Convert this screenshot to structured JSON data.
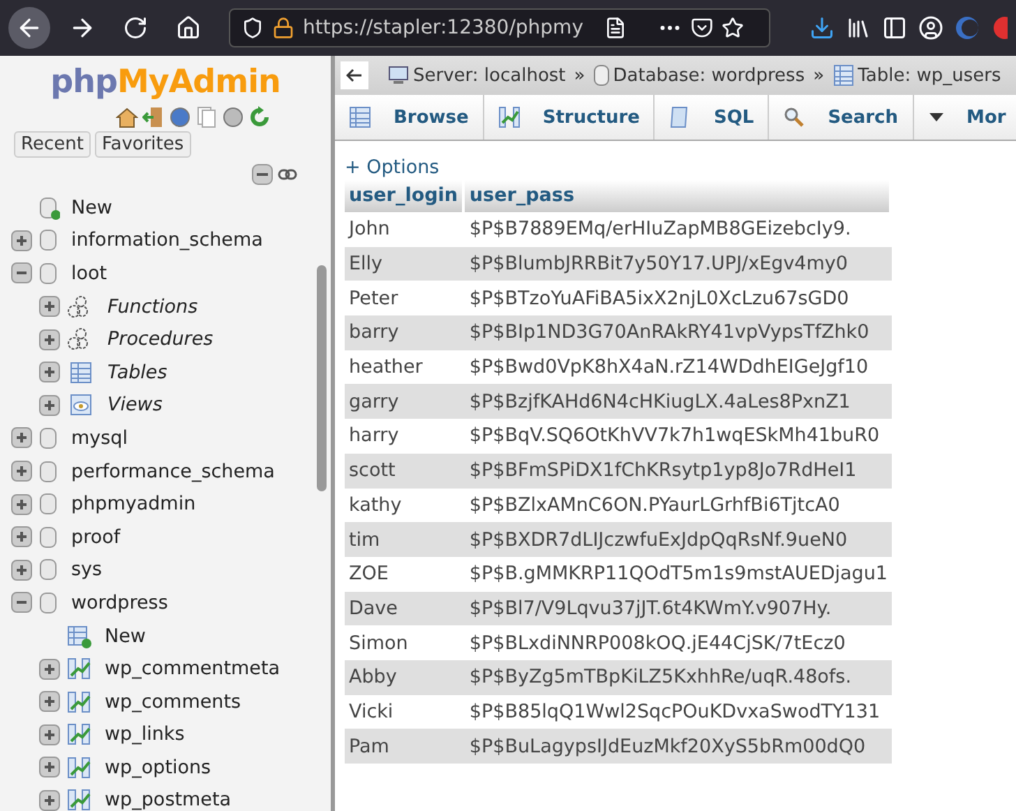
{
  "browser": {
    "url": "https://stapler:12380/phpmy"
  },
  "sidebar": {
    "logo": {
      "prefix": "php",
      "name": "MyAdmin"
    },
    "buttons": [
      "Recent",
      "Favorites"
    ],
    "tree": [
      {
        "label": "New",
        "kind": "new-db"
      },
      {
        "label": "information_schema",
        "kind": "db",
        "expanded": false
      },
      {
        "label": "loot",
        "kind": "db",
        "expanded": true,
        "children": [
          {
            "label": "Functions",
            "kind": "routines",
            "expanded": false
          },
          {
            "label": "Procedures",
            "kind": "routines",
            "expanded": false
          },
          {
            "label": "Tables",
            "kind": "tables",
            "expanded": false
          },
          {
            "label": "Views",
            "kind": "views",
            "expanded": false
          }
        ]
      },
      {
        "label": "mysql",
        "kind": "db",
        "expanded": false
      },
      {
        "label": "performance_schema",
        "kind": "db",
        "expanded": false
      },
      {
        "label": "phpmyadmin",
        "kind": "db",
        "expanded": false
      },
      {
        "label": "proof",
        "kind": "db",
        "expanded": false
      },
      {
        "label": "sys",
        "kind": "db",
        "expanded": false
      },
      {
        "label": "wordpress",
        "kind": "db",
        "expanded": true,
        "children": [
          {
            "label": "New",
            "kind": "new-table"
          },
          {
            "label": "wp_commentmeta",
            "kind": "table",
            "expanded": false
          },
          {
            "label": "wp_comments",
            "kind": "table",
            "expanded": false
          },
          {
            "label": "wp_links",
            "kind": "table",
            "expanded": false
          },
          {
            "label": "wp_options",
            "kind": "table",
            "expanded": false
          },
          {
            "label": "wp_postmeta",
            "kind": "table",
            "expanded": false
          }
        ]
      }
    ]
  },
  "breadcrumbs": [
    {
      "label": "Server: localhost",
      "kind": "server"
    },
    {
      "separator": "»",
      "label": "Database: wordpress",
      "kind": "database"
    },
    {
      "separator": "»",
      "label": "Table: wp_users",
      "kind": "table"
    }
  ],
  "tabs": [
    {
      "label": "Browse",
      "kind": "browse",
      "selected": false
    },
    {
      "label": "Structure",
      "kind": "structure",
      "selected": false
    },
    {
      "label": "SQL",
      "kind": "sql",
      "selected": false
    },
    {
      "label": "Search",
      "kind": "search",
      "selected": false
    },
    {
      "label": "Mor",
      "kind": "more",
      "selected": false
    }
  ],
  "options": "+ Options",
  "table": {
    "columns": [
      "user_login",
      "user_pass"
    ],
    "rows": [
      [
        "John",
        "$P$B7889EMq/erHIuZapMB8GEizebcIy9."
      ],
      [
        "Elly",
        "$P$BlumbJRRBit7y50Y17.UPJ/xEgv4my0"
      ],
      [
        "Peter",
        "$P$BTzoYuAFiBA5ixX2njL0XcLzu67sGD0"
      ],
      [
        "barry",
        "$P$BIp1ND3G70AnRAkRY41vpVypsTfZhk0"
      ],
      [
        "heather",
        "$P$Bwd0VpK8hX4aN.rZ14WDdhEIGeJgf10"
      ],
      [
        "garry",
        "$P$BzjfKAHd6N4cHKiugLX.4aLes8PxnZ1"
      ],
      [
        "harry",
        "$P$BqV.SQ6OtKhVV7k7h1wqESkMh41buR0"
      ],
      [
        "scott",
        "$P$BFmSPiDX1fChKRsytp1yp8Jo7RdHeI1"
      ],
      [
        "kathy",
        "$P$BZlxAMnC6ON.PYaurLGrhfBi6TjtcA0"
      ],
      [
        "tim",
        "$P$BXDR7dLIJczwfuExJdpQqRsNf.9ueN0"
      ],
      [
        "ZOE",
        "$P$B.gMMKRP11QOdT5m1s9mstAUEDjagu1"
      ],
      [
        "Dave",
        "$P$Bl7/V9Lqvu37jJT.6t4KWmY.v907Hy."
      ],
      [
        "Simon",
        "$P$BLxdiNNRP008kOQ.jE44CjSK/7tEcz0"
      ],
      [
        "Abby",
        "$P$ByZg5mTBpKiLZ5KxhhRe/uqR.48ofs."
      ],
      [
        "Vicki",
        "$P$B85lqQ1Wwl2SqcPOuKDvxaSwodTY131"
      ],
      [
        "Pam",
        "$P$BuLagypsIJdEuzMkf20XyS5bRm00dQ0"
      ]
    ]
  }
}
